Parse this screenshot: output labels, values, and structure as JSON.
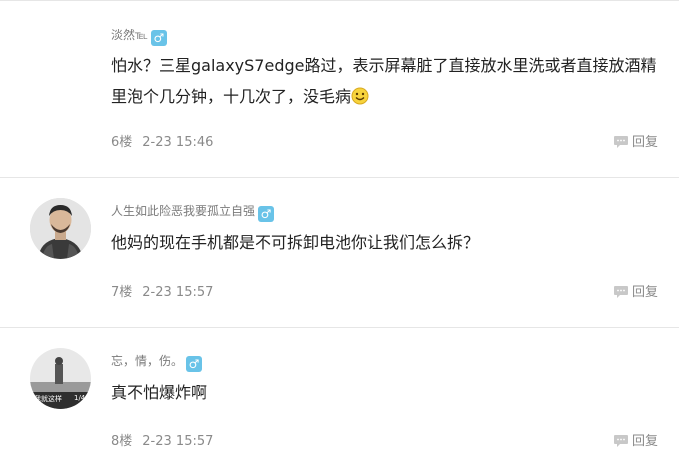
{
  "comments": [
    {
      "username": "淡然℡",
      "gender_icon": "male-icon",
      "gender_symbol": "♂",
      "content_line1": "怕水？三星galaxyS7edge路过，表示屏幕脏了直接放水里洗或者直接放酒精",
      "content_line2": "里泡个几分钟，十几次了，没毛病",
      "emoji": "smile-emoji-icon",
      "floor": "6楼",
      "time": "2-23 15:46",
      "reply_label": "回复"
    },
    {
      "username": "人生如此险恶我要孤立自强",
      "gender_icon": "male-icon",
      "gender_symbol": "♂",
      "content": "他妈的现在手机都是不可拆卸电池你让我们怎么拆？",
      "floor": "7楼",
      "time": "2-23 15:57",
      "reply_label": "回复"
    },
    {
      "username": "忘，情，伤。",
      "gender_icon": "male-icon",
      "gender_symbol": "♂",
      "content": "真不怕爆炸啊",
      "avatar_caption": "我就这样",
      "avatar_caption_right": "1/4",
      "floor": "8楼",
      "time": "2-23 15:57",
      "reply_label": "回复"
    }
  ],
  "colors": {
    "gender_badge": "#69c3e8",
    "divider": "#e6e6e6",
    "meta_text": "#8a8a8a"
  }
}
